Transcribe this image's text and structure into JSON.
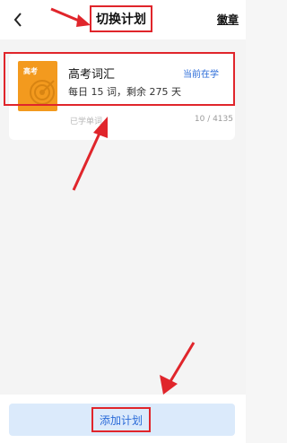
{
  "nav": {
    "title": "切换计划",
    "badge_label": "徽章",
    "back_icon": "chevron-left-icon"
  },
  "plan": {
    "book_cover_title": "高考",
    "name": "高考词汇",
    "status": "当前在学",
    "meta": "每日 15 词，剩余 275  天",
    "learned_label": "已学单词",
    "progress": "10 / 4135"
  },
  "footer": {
    "add_label": "添加计划"
  },
  "colors": {
    "accent": "#2a6bd8",
    "annotation_red": "#e0252b",
    "book_orange": "#f39a1e",
    "button_bg": "#dbeafb"
  }
}
